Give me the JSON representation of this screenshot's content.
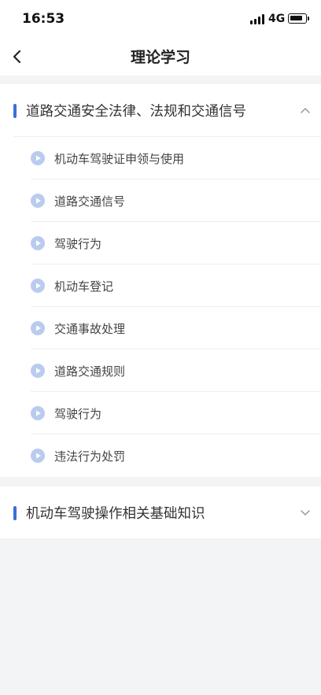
{
  "status_bar": {
    "time": "16:53",
    "network": "4G"
  },
  "header": {
    "title": "理论学习"
  },
  "colors": {
    "accent": "#3b6fd6",
    "play_icon_bg": "#b9cbef",
    "page_bg": "#f3f4f6"
  },
  "sections": [
    {
      "title": "道路交通安全法律、法规和交通信号",
      "expanded": true,
      "chevron_icon": "chevron-up-icon",
      "items": [
        {
          "label": "机动车驾驶证申领与使用"
        },
        {
          "label": "道路交通信号"
        },
        {
          "label": "驾驶行为"
        },
        {
          "label": "机动车登记"
        },
        {
          "label": "交通事故处理"
        },
        {
          "label": "道路交通规则"
        },
        {
          "label": "驾驶行为"
        },
        {
          "label": "违法行为处罚"
        }
      ]
    },
    {
      "title": "机动车驾驶操作相关基础知识",
      "expanded": false,
      "chevron_icon": "chevron-down-icon",
      "items": []
    }
  ]
}
